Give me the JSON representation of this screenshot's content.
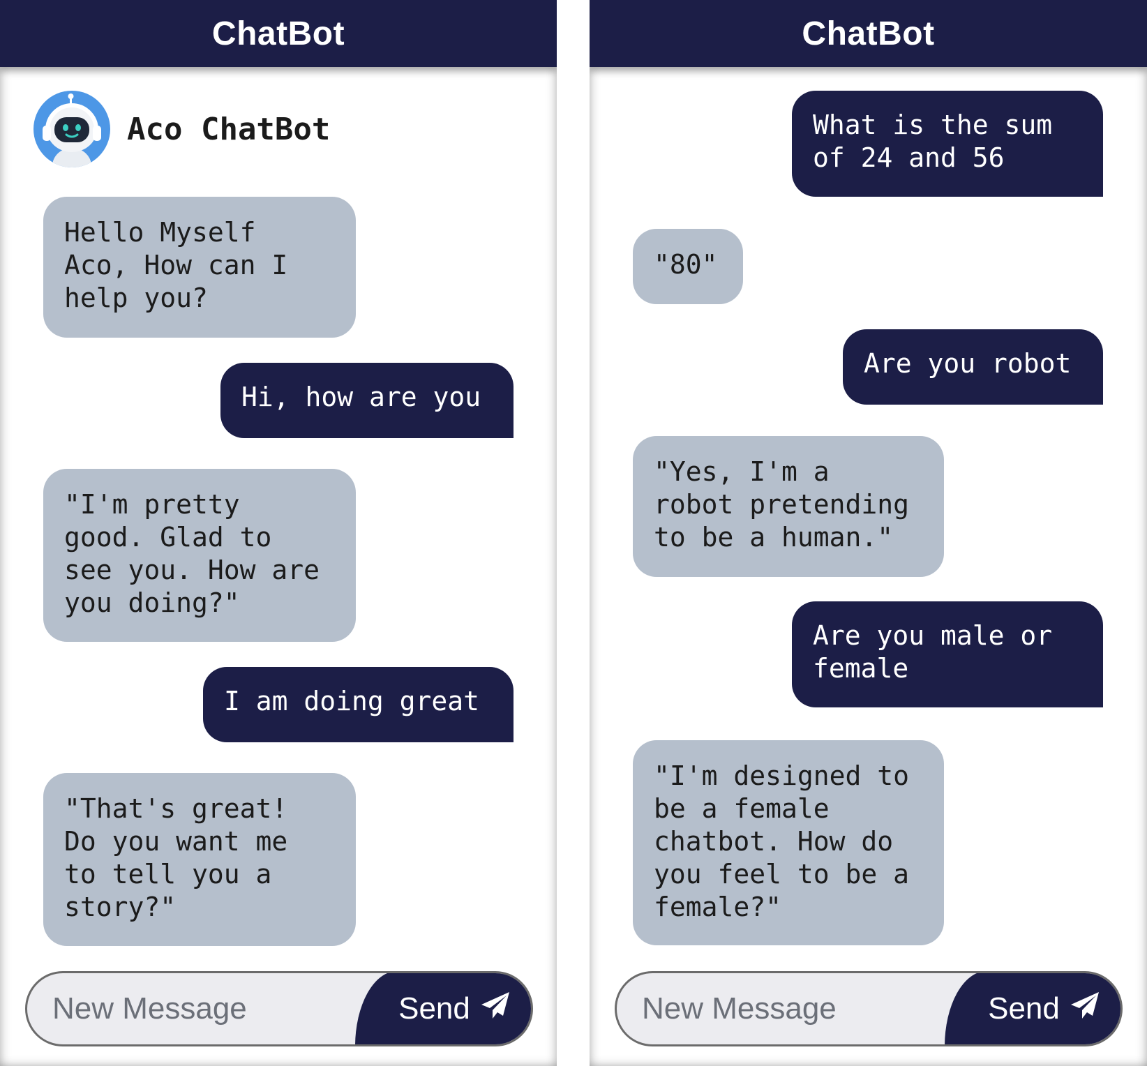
{
  "left_screen": {
    "header": {
      "title": "ChatBot"
    },
    "bot_profile": {
      "name": "Aco ChatBot",
      "avatar_icon": "robot-headset-icon"
    },
    "messages": [
      {
        "sender": "bot",
        "text": "Hello Myself\nAco, How can I\nhelp you?"
      },
      {
        "sender": "user",
        "text": "Hi, how are you"
      },
      {
        "sender": "bot",
        "text": "\"I'm pretty\ngood. Glad to\nsee you. How are\nyou doing?\""
      },
      {
        "sender": "user",
        "text": "I am doing great"
      },
      {
        "sender": "bot",
        "text": "\"That's great!\nDo you want me\nto tell you a\nstory?\""
      }
    ],
    "composer": {
      "placeholder": "New Message",
      "send_label": "Send",
      "send_icon": "paper-plane-icon"
    }
  },
  "right_screen": {
    "header": {
      "title": "ChatBot"
    },
    "messages": [
      {
        "sender": "user",
        "text": "What is the sum\nof 24 and 56"
      },
      {
        "sender": "bot",
        "text": "\"80\""
      },
      {
        "sender": "user",
        "text": "Are you robot"
      },
      {
        "sender": "bot",
        "text": "\"Yes, I'm a\nrobot pretending\nto be a human.\""
      },
      {
        "sender": "user",
        "text": "Are you male or\nfemale"
      },
      {
        "sender": "bot",
        "text": "\"I'm designed to\nbe a female\nchatbot. How do\nyou feel to be a\nfemale?\""
      }
    ],
    "composer": {
      "placeholder": "New Message",
      "send_label": "Send",
      "send_icon": "paper-plane-icon"
    }
  },
  "colors": {
    "header_bg": "#1c1e47",
    "user_bubble": "#1c1e47",
    "bot_bubble": "#b5bfcc",
    "avatar_bg": "#4d97e6",
    "composer_bg": "#ececf0"
  }
}
